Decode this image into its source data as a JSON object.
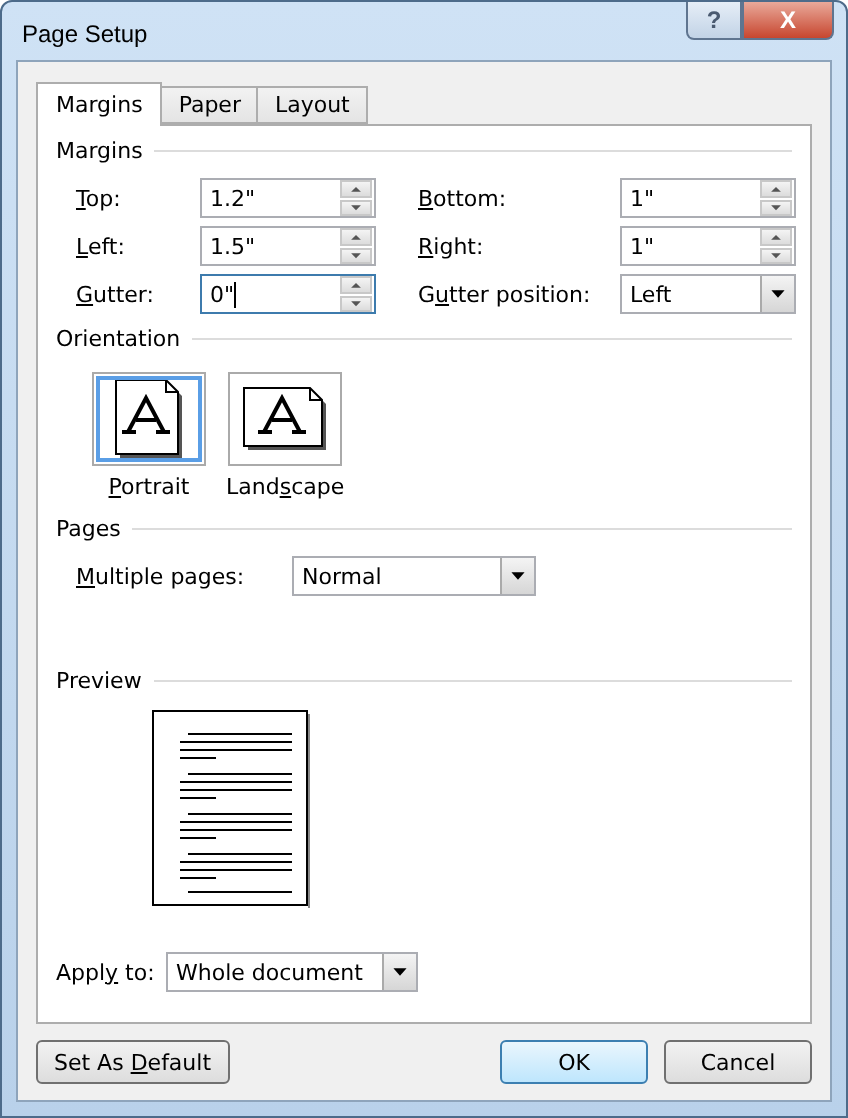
{
  "window": {
    "title": "Page Setup",
    "help_button": "?",
    "close_button": "X"
  },
  "tabs": [
    {
      "label": "Margins",
      "selected": true
    },
    {
      "label": "Paper",
      "selected": false
    },
    {
      "label": "Layout",
      "selected": false
    }
  ],
  "margins": {
    "heading": "Margins",
    "fields": [
      {
        "access_key": "T",
        "label_end": "op:",
        "kind": "spin",
        "value": "1.2\"",
        "focused": false
      },
      {
        "access_key": "B",
        "label_end": "ottom:",
        "kind": "spin",
        "value": "1\"",
        "focused": false
      },
      {
        "access_key": "L",
        "label_end": "eft:",
        "kind": "spin",
        "value": "1.5\"",
        "focused": false
      },
      {
        "access_key": "R",
        "label_end": "ight:",
        "kind": "spin",
        "value": "1\"",
        "focused": false
      },
      {
        "access_key": "G",
        "label_end": "utter:",
        "kind": "spin",
        "value": "0\"",
        "focused": true
      },
      {
        "label_start": "G",
        "access_key": "u",
        "label_end": "tter position:",
        "kind": "dropdown",
        "value": "Left",
        "focused": false
      }
    ]
  },
  "orientation": {
    "heading": "Orientation",
    "options": [
      {
        "access_key": "P",
        "label_end": "ortrait",
        "kind": "portrait",
        "selected": true
      },
      {
        "label_start": "Land",
        "access_key": "s",
        "label_end": "cape",
        "kind": "landscape",
        "selected": false
      }
    ]
  },
  "pages": {
    "heading": "Pages",
    "access_key": "M",
    "label_end": "ultiple pages:",
    "value": "Normal"
  },
  "preview": {
    "heading": "Preview"
  },
  "apply_to": {
    "label_start": "Appl",
    "access_key": "y",
    "label_end": " to:",
    "value": "Whole document"
  },
  "buttons": [
    {
      "label_start": "Set As ",
      "access_key": "D",
      "label_end": "efault",
      "kind": "left",
      "default": false
    },
    {
      "label_start": "OK",
      "kind": "right",
      "default": true
    },
    {
      "label_start": "Cancel",
      "kind": "right",
      "default": false
    }
  ]
}
